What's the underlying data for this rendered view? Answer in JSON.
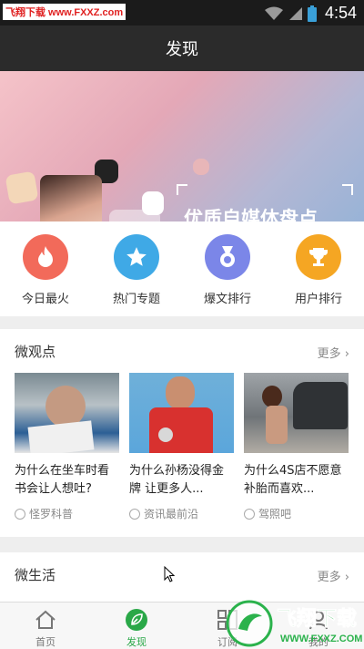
{
  "status_bar": {
    "watermark": "飞翔下载 www.FXXZ.com",
    "time": "4:54"
  },
  "header": {
    "title": "发现"
  },
  "banner": {
    "title": "优质自媒体盘点"
  },
  "quick_links": [
    {
      "label": "今日最火",
      "icon": "flame-icon",
      "color": "#f26a5a"
    },
    {
      "label": "热门专题",
      "icon": "star-icon",
      "color": "#3fa9e6"
    },
    {
      "label": "爆文排行",
      "icon": "medal-icon",
      "color": "#7b86e8"
    },
    {
      "label": "用户排行",
      "icon": "trophy-icon",
      "color": "#f5a623"
    }
  ],
  "micro_views": {
    "title": "微观点",
    "more": "更多",
    "cards": [
      {
        "title": "为什么在坐车时看书会让人想吐?",
        "source": "怪罗科普"
      },
      {
        "title": "为什么孙杨没得金牌 让更多人...",
        "source": "资讯最前沿"
      },
      {
        "title": "为什么4S店不愿意补胎而喜欢...",
        "source": "驾照吧"
      }
    ]
  },
  "micro_life": {
    "title": "微生活",
    "more": "更多"
  },
  "tabs": [
    {
      "label": "首页",
      "icon": "home-icon"
    },
    {
      "label": "发现",
      "icon": "leaf-icon",
      "active": true
    },
    {
      "label": "订阅",
      "icon": "subscribe-icon"
    },
    {
      "label": "我的",
      "icon": "user-icon"
    }
  ],
  "watermark_logo": {
    "text": "飞翔下载",
    "url": "WWW.FXXZ.COM"
  },
  "colors": {
    "accent": "#2aa848",
    "header_bg": "#2b2b2b"
  }
}
